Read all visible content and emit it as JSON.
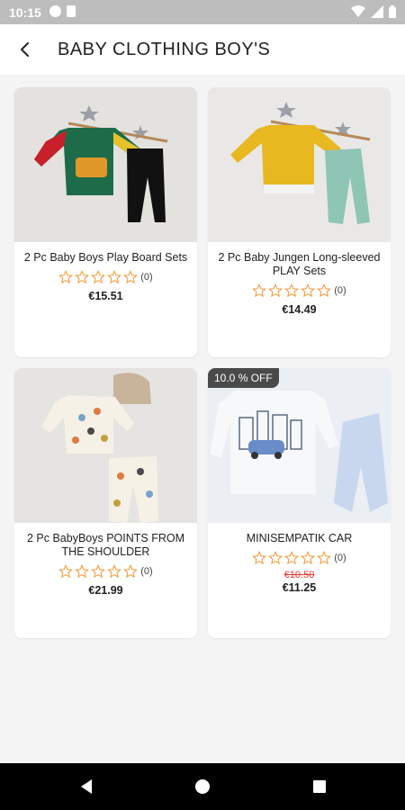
{
  "status_bar": {
    "time": "10:15",
    "icons": [
      "notification-icon",
      "sd-card-icon",
      "wifi-icon",
      "signal-icon",
      "battery-icon"
    ]
  },
  "app_bar": {
    "back_icon": "arrow-back-icon",
    "title": "BABY CLOTHING BOY'S"
  },
  "products": [
    {
      "name": "2 Pc Baby Boys Play Board Sets",
      "rating_count": "(0)",
      "price": "€15.51",
      "image": "product-photo-play-board-set"
    },
    {
      "name": "2 Pc Baby Jungen Long-sleeved PLAY Sets",
      "rating_count": "(0)",
      "price": "€14.49",
      "image": "product-photo-long-sleeved-play-set"
    },
    {
      "name": "2 Pc BabyBoys POINTS FROM THE SHOULDER",
      "rating_count": "(0)",
      "price": "€21.99",
      "image": "product-photo-points-set"
    },
    {
      "name": "MINISEMPATIK CAR",
      "rating_count": "(0)",
      "badge": "10.0 % OFF",
      "old_price": "€10.50",
      "price": "€11.25",
      "image": "product-photo-car-set"
    }
  ],
  "colors": {
    "star": "#f39c3c",
    "badge_bg": "#4a4a4a",
    "old_price": "#e53935",
    "status_bar": "#bdbdbd",
    "nav_bar": "#000000"
  },
  "nav_bar": {
    "icons": [
      "back-triangle-icon",
      "home-circle-icon",
      "recents-square-icon"
    ]
  }
}
